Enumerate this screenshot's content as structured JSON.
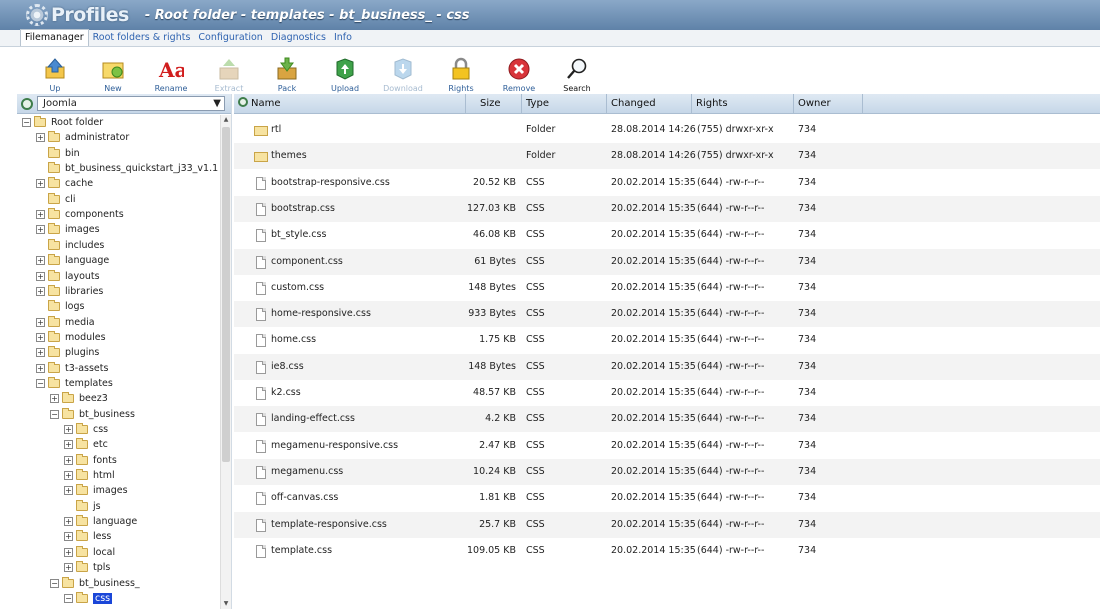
{
  "title": {
    "logo": "Profiles",
    "path": "- Root folder - templates - bt_business_ - css"
  },
  "tabs": [
    "Filemanager",
    "Root folders & rights",
    "Configuration",
    "Diagnostics",
    "Info"
  ],
  "toolbar": [
    {
      "label": "Up",
      "icon": "up-arrow-icon",
      "enabled": true
    },
    {
      "label": "New",
      "icon": "new-folder-icon",
      "enabled": true
    },
    {
      "label": "Rename",
      "icon": "rename-icon",
      "enabled": true
    },
    {
      "label": "Extract",
      "icon": "extract-icon",
      "enabled": false
    },
    {
      "label": "Pack",
      "icon": "pack-icon",
      "enabled": true
    },
    {
      "label": "Upload",
      "icon": "upload-icon",
      "enabled": true
    },
    {
      "label": "Download",
      "icon": "download-icon",
      "enabled": false
    },
    {
      "label": "Rights",
      "icon": "lock-icon",
      "enabled": true
    },
    {
      "label": "Remove",
      "icon": "remove-icon",
      "enabled": true
    },
    {
      "label": "Search",
      "icon": "search-icon",
      "enabled": true
    }
  ],
  "left": {
    "select": "Joomla"
  },
  "tree": [
    {
      "name": "Root folder",
      "depth": 0,
      "toggle": "−"
    },
    {
      "name": "administrator",
      "depth": 1,
      "toggle": "+"
    },
    {
      "name": "bin",
      "depth": 1,
      "toggle": ""
    },
    {
      "name": "bt_business_quickstart_j33_v1.1",
      "depth": 1,
      "toggle": ""
    },
    {
      "name": "cache",
      "depth": 1,
      "toggle": "+"
    },
    {
      "name": "cli",
      "depth": 1,
      "toggle": ""
    },
    {
      "name": "components",
      "depth": 1,
      "toggle": "+"
    },
    {
      "name": "images",
      "depth": 1,
      "toggle": "+"
    },
    {
      "name": "includes",
      "depth": 1,
      "toggle": ""
    },
    {
      "name": "language",
      "depth": 1,
      "toggle": "+"
    },
    {
      "name": "layouts",
      "depth": 1,
      "toggle": "+"
    },
    {
      "name": "libraries",
      "depth": 1,
      "toggle": "+"
    },
    {
      "name": "logs",
      "depth": 1,
      "toggle": ""
    },
    {
      "name": "media",
      "depth": 1,
      "toggle": "+"
    },
    {
      "name": "modules",
      "depth": 1,
      "toggle": "+"
    },
    {
      "name": "plugins",
      "depth": 1,
      "toggle": "+"
    },
    {
      "name": "t3-assets",
      "depth": 1,
      "toggle": "+"
    },
    {
      "name": "templates",
      "depth": 1,
      "toggle": "−"
    },
    {
      "name": "beez3",
      "depth": 2,
      "toggle": "+"
    },
    {
      "name": "bt_business",
      "depth": 2,
      "toggle": "−"
    },
    {
      "name": "css",
      "depth": 3,
      "toggle": "+"
    },
    {
      "name": "etc",
      "depth": 3,
      "toggle": "+"
    },
    {
      "name": "fonts",
      "depth": 3,
      "toggle": "+"
    },
    {
      "name": "html",
      "depth": 3,
      "toggle": "+"
    },
    {
      "name": "images",
      "depth": 3,
      "toggle": "+"
    },
    {
      "name": "js",
      "depth": 3,
      "toggle": ""
    },
    {
      "name": "language",
      "depth": 3,
      "toggle": "+"
    },
    {
      "name": "less",
      "depth": 3,
      "toggle": "+"
    },
    {
      "name": "local",
      "depth": 3,
      "toggle": "+"
    },
    {
      "name": "tpls",
      "depth": 3,
      "toggle": "+"
    },
    {
      "name": "bt_business_",
      "depth": 2,
      "toggle": "−"
    },
    {
      "name": "css",
      "depth": 3,
      "toggle": "−",
      "selected": true
    }
  ],
  "columns": {
    "name": "Name",
    "size": "Size",
    "type": "Type",
    "changed": "Changed",
    "rights": "Rights",
    "owner": "Owner"
  },
  "files": [
    {
      "name": "rtl",
      "size": "",
      "type": "Folder",
      "changed": "28.08.2014 14:26",
      "rights": "(755) drwxr-xr-x",
      "owner": "734",
      "folder": true
    },
    {
      "name": "themes",
      "size": "",
      "type": "Folder",
      "changed": "28.08.2014 14:26",
      "rights": "(755) drwxr-xr-x",
      "owner": "734",
      "folder": true
    },
    {
      "name": "bootstrap-responsive.css",
      "size": "20.52 KB",
      "type": "CSS",
      "changed": "20.02.2014 15:35",
      "rights": "(644) -rw-r--r--",
      "owner": "734"
    },
    {
      "name": "bootstrap.css",
      "size": "127.03 KB",
      "type": "CSS",
      "changed": "20.02.2014 15:35",
      "rights": "(644) -rw-r--r--",
      "owner": "734"
    },
    {
      "name": "bt_style.css",
      "size": "46.08 KB",
      "type": "CSS",
      "changed": "20.02.2014 15:35",
      "rights": "(644) -rw-r--r--",
      "owner": "734"
    },
    {
      "name": "component.css",
      "size": "61 Bytes",
      "type": "CSS",
      "changed": "20.02.2014 15:35",
      "rights": "(644) -rw-r--r--",
      "owner": "734"
    },
    {
      "name": "custom.css",
      "size": "148 Bytes",
      "type": "CSS",
      "changed": "20.02.2014 15:35",
      "rights": "(644) -rw-r--r--",
      "owner": "734"
    },
    {
      "name": "home-responsive.css",
      "size": "933 Bytes",
      "type": "CSS",
      "changed": "20.02.2014 15:35",
      "rights": "(644) -rw-r--r--",
      "owner": "734"
    },
    {
      "name": "home.css",
      "size": "1.75 KB",
      "type": "CSS",
      "changed": "20.02.2014 15:35",
      "rights": "(644) -rw-r--r--",
      "owner": "734"
    },
    {
      "name": "ie8.css",
      "size": "148 Bytes",
      "type": "CSS",
      "changed": "20.02.2014 15:35",
      "rights": "(644) -rw-r--r--",
      "owner": "734"
    },
    {
      "name": "k2.css",
      "size": "48.57 KB",
      "type": "CSS",
      "changed": "20.02.2014 15:35",
      "rights": "(644) -rw-r--r--",
      "owner": "734"
    },
    {
      "name": "landing-effect.css",
      "size": "4.2 KB",
      "type": "CSS",
      "changed": "20.02.2014 15:35",
      "rights": "(644) -rw-r--r--",
      "owner": "734"
    },
    {
      "name": "megamenu-responsive.css",
      "size": "2.47 KB",
      "type": "CSS",
      "changed": "20.02.2014 15:35",
      "rights": "(644) -rw-r--r--",
      "owner": "734"
    },
    {
      "name": "megamenu.css",
      "size": "10.24 KB",
      "type": "CSS",
      "changed": "20.02.2014 15:35",
      "rights": "(644) -rw-r--r--",
      "owner": "734"
    },
    {
      "name": "off-canvas.css",
      "size": "1.81 KB",
      "type": "CSS",
      "changed": "20.02.2014 15:35",
      "rights": "(644) -rw-r--r--",
      "owner": "734"
    },
    {
      "name": "template-responsive.css",
      "size": "25.7 KB",
      "type": "CSS",
      "changed": "20.02.2014 15:35",
      "rights": "(644) -rw-r--r--",
      "owner": "734"
    },
    {
      "name": "template.css",
      "size": "109.05 KB",
      "type": "CSS",
      "changed": "20.02.2014 15:35",
      "rights": "(644) -rw-r--r--",
      "owner": "734"
    }
  ]
}
